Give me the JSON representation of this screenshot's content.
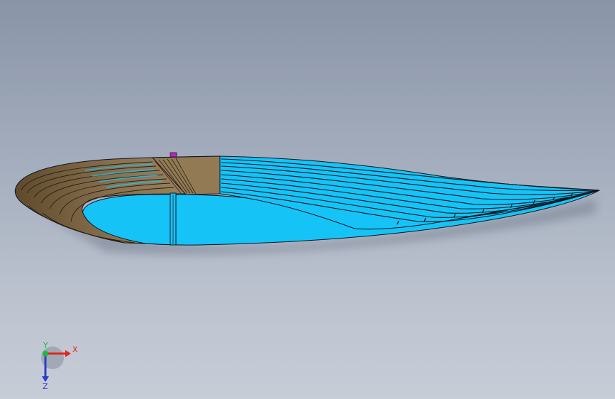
{
  "viewport": {
    "background_top": "#8994a7",
    "background_bottom": "#c7cdd7"
  },
  "model": {
    "leading_edge_color": "#7a6442",
    "skin_color": "#16c3f7",
    "edge_color": "#10141c",
    "marker_color": "#b02ab8"
  },
  "triad": {
    "x_label": "X",
    "y_label": "Y",
    "z_label": "Z",
    "x_color": "#e0281e",
    "y_color": "#1cb83a",
    "z_color": "#2a3fc8"
  }
}
